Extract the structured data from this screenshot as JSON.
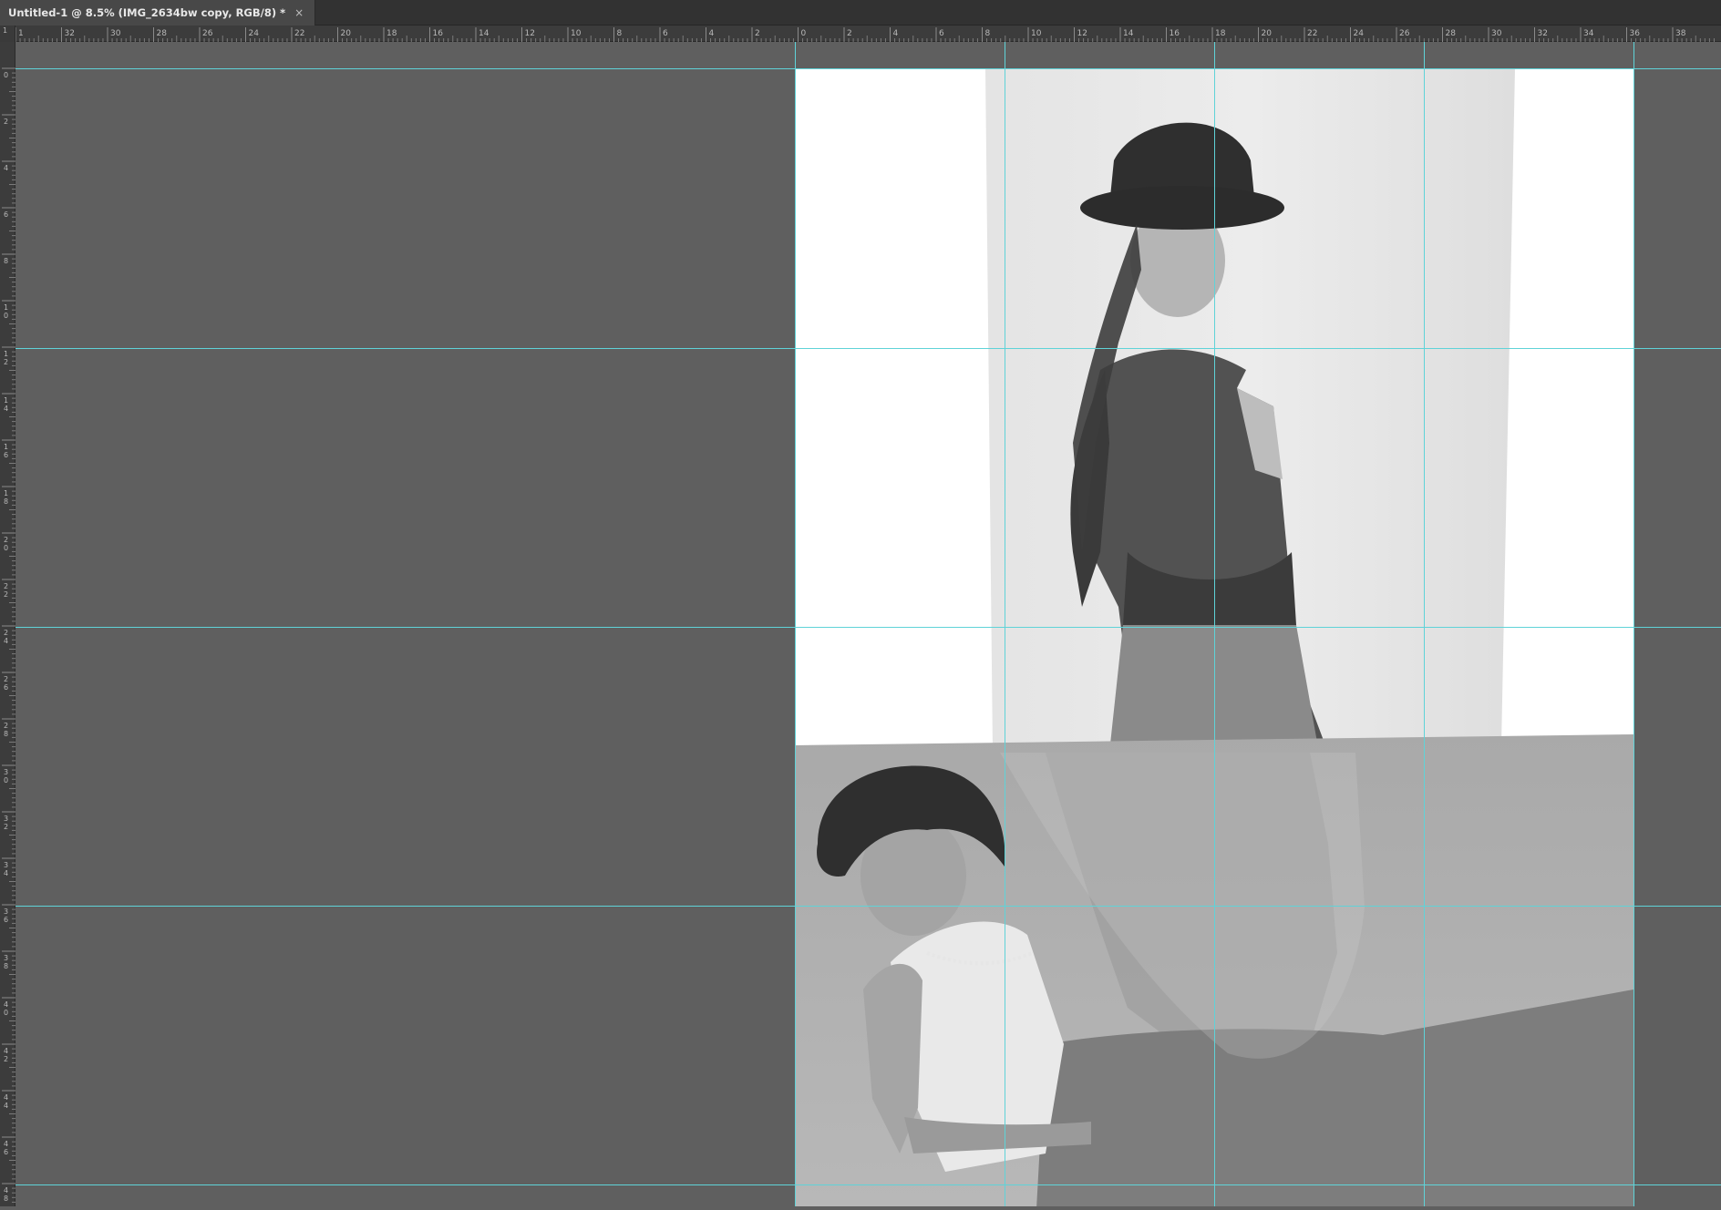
{
  "document_tab": {
    "title": "Untitled-1 @ 8.5% (IMG_2634bw copy, RGB/8) *",
    "close_glyph": "×"
  },
  "rulers": {
    "horizontal_labels": [
      "1",
      "32",
      "30",
      "28",
      "26",
      "24",
      "22",
      "20",
      "18",
      "16",
      "14",
      "12",
      "10",
      "8",
      "6",
      "4",
      "2",
      "0",
      "2",
      "4",
      "6",
      "8",
      "10",
      "12",
      "14",
      "16",
      "18",
      "20",
      "22",
      "24",
      "26",
      "28",
      "30",
      "32",
      "34",
      "36",
      "38"
    ],
    "vertical_labels": [
      "0",
      "2",
      "4",
      "6",
      "8",
      "10",
      "12",
      "14",
      "16",
      "18",
      "20",
      "22",
      "24",
      "26",
      "28",
      "30",
      "32",
      "34",
      "36",
      "38",
      "40",
      "42",
      "44",
      "46",
      "48"
    ]
  },
  "colors": {
    "guide": "#5fd3d8",
    "pasteboard": "#5f5f5f",
    "canvas": "#ffffff",
    "ruler": "#3c3c3c",
    "tabbar": "#323232"
  },
  "icons": {
    "close": "close-icon"
  }
}
